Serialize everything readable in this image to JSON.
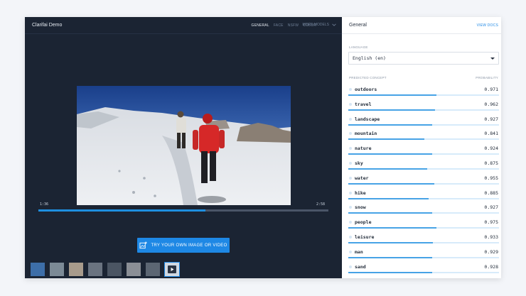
{
  "app": {
    "title": "Clarifai Demo"
  },
  "tabs": [
    {
      "label": "GENERAL",
      "active": true
    },
    {
      "label": "FACE",
      "active": false
    },
    {
      "label": "NSFW",
      "active": false
    },
    {
      "label": "COLOR",
      "active": false
    }
  ],
  "more_models": {
    "label": "MORE MODELS",
    "icon": "chevron-down-icon"
  },
  "video": {
    "current_time": "1:36",
    "duration": "2:58",
    "progress": 0.576
  },
  "cta": {
    "label": "TRY YOUR OWN IMAGE OR VIDEO",
    "icon": "add-image-icon",
    "color": "#1e88e5"
  },
  "thumbnails": {
    "count": 8,
    "selected_index": 7,
    "selected_icon": "play-icon"
  },
  "panel": {
    "title": "General",
    "docs_label": "VIEW DOCS",
    "language_label": "LANGUAGE",
    "language_value": "English (en)",
    "concept_header": "PREDICTED CONCEPT",
    "probability_header": "PROBABILITY",
    "accent": "#47a3e6"
  },
  "concepts": [
    {
      "name": "outdoors",
      "value": "0.971",
      "p": 0.971
    },
    {
      "name": "travel",
      "value": "0.962",
      "p": 0.962
    },
    {
      "name": "landscape",
      "value": "0.927",
      "p": 0.927
    },
    {
      "name": "mountain",
      "value": "0.841",
      "p": 0.841
    },
    {
      "name": "nature",
      "value": "0.924",
      "p": 0.924
    },
    {
      "name": "sky",
      "value": "0.875",
      "p": 0.875
    },
    {
      "name": "water",
      "value": "0.955",
      "p": 0.955
    },
    {
      "name": "hike",
      "value": "0.885",
      "p": 0.885
    },
    {
      "name": "snow",
      "value": "0.927",
      "p": 0.927
    },
    {
      "name": "people",
      "value": "0.975",
      "p": 0.975
    },
    {
      "name": "leisure",
      "value": "0.933",
      "p": 0.933
    },
    {
      "name": "man",
      "value": "0.929",
      "p": 0.929
    },
    {
      "name": "sand",
      "value": "0.928",
      "p": 0.928
    }
  ]
}
